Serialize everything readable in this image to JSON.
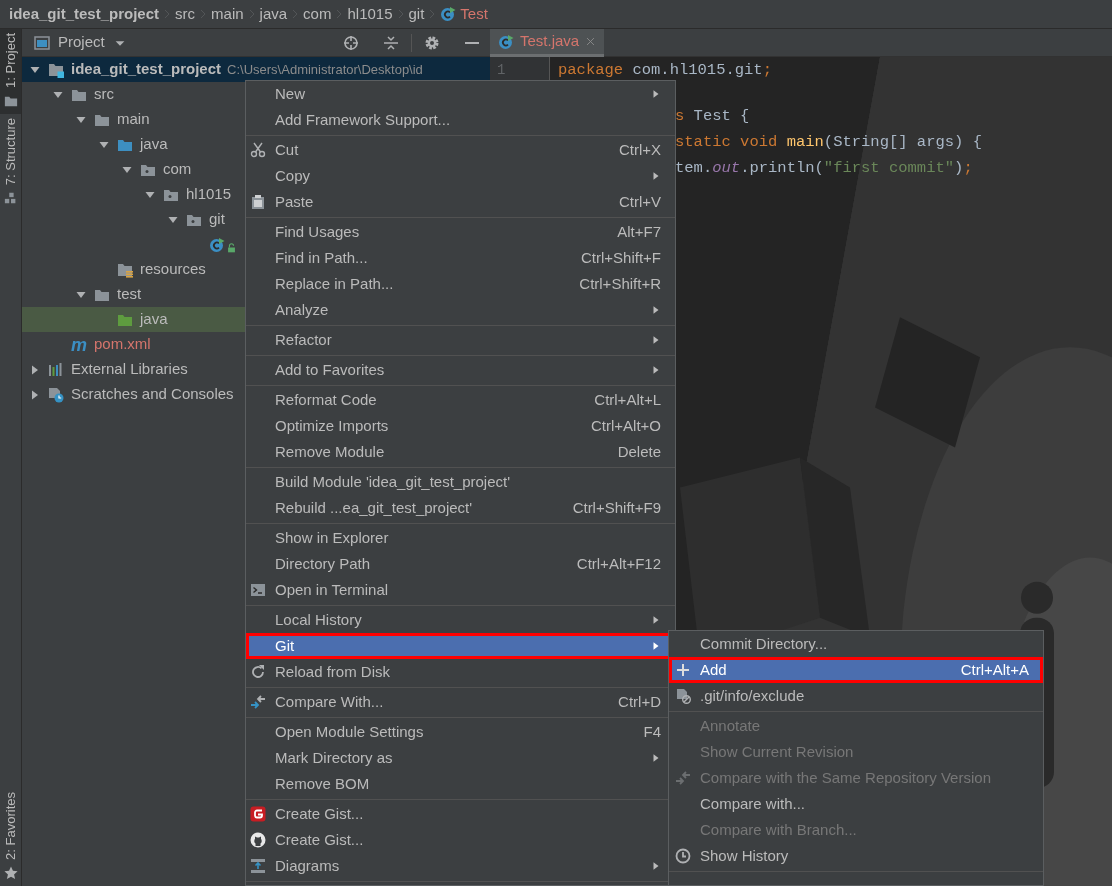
{
  "breadcrumb": [
    {
      "label": "idea_git_test_project",
      "kind": "module",
      "untracked": false
    },
    {
      "label": "src",
      "kind": "folder",
      "untracked": false
    },
    {
      "label": "main",
      "kind": "folder",
      "untracked": false
    },
    {
      "label": "java",
      "kind": "folder",
      "untracked": false
    },
    {
      "label": "com",
      "kind": "folder",
      "untracked": false
    },
    {
      "label": "hl1015",
      "kind": "folder",
      "untracked": false
    },
    {
      "label": "git",
      "kind": "folder",
      "untracked": false
    },
    {
      "label": "Test",
      "kind": "class",
      "untracked": true
    }
  ],
  "tool_strip": {
    "top": [
      {
        "label": "1: Project",
        "selected": true
      },
      {
        "label": "7: Structure",
        "selected": false
      }
    ],
    "bottom": [
      {
        "label": "2: Favorites",
        "selected": false
      }
    ]
  },
  "project_panel": {
    "title": "Project",
    "tree": [
      {
        "label": "idea_git_test_project",
        "kind": "module",
        "detail": "C:\\Users\\Administrator\\Desktop\\id",
        "expanded": true,
        "selected": false,
        "highlighted": true,
        "untracked": false,
        "children": [
          {
            "label": "src",
            "kind": "folder",
            "expanded": true,
            "selected": false,
            "highlighted": false,
            "untracked": false,
            "children": [
              {
                "label": "main",
                "kind": "folder",
                "expanded": true,
                "selected": false,
                "highlighted": false,
                "untracked": false,
                "children": [
                  {
                    "label": "java",
                    "kind": "source",
                    "expanded": true,
                    "selected": false,
                    "highlighted": false,
                    "untracked": false,
                    "children": [
                      {
                        "label": "com",
                        "kind": "package",
                        "expanded": true,
                        "selected": false,
                        "highlighted": false,
                        "untracked": false,
                        "children": [
                          {
                            "label": "hl1015",
                            "kind": "package",
                            "expanded": true,
                            "selected": false,
                            "highlighted": false,
                            "untracked": false,
                            "children": [
                              {
                                "label": "git",
                                "kind": "package",
                                "expanded": true,
                                "selected": false,
                                "highlighted": false,
                                "untracked": false,
                                "children": [
                                  {
                                    "kind": "class",
                                    "locked": true,
                                    "selected": false,
                                    "highlighted": false
                                  }
                                ]
                              }
                            ]
                          }
                        ]
                      }
                    ]
                  },
                  {
                    "label": "resources",
                    "kind": "resources",
                    "selected": false,
                    "highlighted": false,
                    "untracked": false
                  }
                ]
              },
              {
                "label": "test",
                "kind": "folder",
                "expanded": true,
                "selected": false,
                "highlighted": false,
                "untracked": false,
                "children": [
                  {
                    "label": "java",
                    "kind": "test",
                    "selected": true,
                    "highlighted": false,
                    "untracked": false
                  }
                ]
              }
            ]
          },
          {
            "label": "pom.xml",
            "kind": "maven",
            "glyph": "m",
            "selected": false,
            "highlighted": false,
            "untracked": true
          }
        ]
      },
      {
        "label": "External Libraries",
        "kind": "libraries",
        "expanded": false,
        "selected": false,
        "highlighted": false,
        "untracked": false
      },
      {
        "label": "Scratches and Consoles",
        "kind": "scratches",
        "expanded": false,
        "selected": false,
        "highlighted": false,
        "untracked": false
      }
    ]
  },
  "editor": {
    "tabs": [
      {
        "label": "Test.java",
        "kind": "class",
        "untracked": true,
        "selected": true
      }
    ],
    "gutter": [
      "1"
    ],
    "code_lines": [
      {
        "gap_before": false,
        "partial": false,
        "tokens": [
          {
            "kind": "keyword",
            "text": "package"
          },
          {
            "kind": "plain",
            "text": " com.hl1015.git"
          },
          {
            "kind": "keyword",
            "text": ";"
          }
        ]
      },
      {
        "gap_before": true,
        "partial": true,
        "tokens": [
          {
            "kind": "keyword",
            "text": "s"
          },
          {
            "kind": "plain",
            "text": " Test {"
          }
        ]
      },
      {
        "gap_before": false,
        "partial": true,
        "tokens": [
          {
            "kind": "keyword",
            "text": "static void "
          },
          {
            "kind": "method",
            "text": "main"
          },
          {
            "kind": "plain",
            "text": "(String[] args) {"
          }
        ]
      },
      {
        "gap_before": false,
        "partial": true,
        "tokens": [
          {
            "kind": "plain",
            "text": "tem."
          },
          {
            "kind": "field",
            "text": "out"
          },
          {
            "kind": "plain",
            "text": ".println("
          },
          {
            "kind": "string",
            "text": "\"first commit\""
          },
          {
            "kind": "plain",
            "text": ")"
          },
          {
            "kind": "keyword",
            "text": ";"
          }
        ]
      }
    ]
  },
  "context_menu": {
    "items": [
      {
        "kind": "plain",
        "label": "New",
        "submenu": true,
        "selected": false,
        "disabled": false,
        "outlined": false
      },
      {
        "kind": "plain",
        "label": "Add Framework Support...",
        "selected": false,
        "disabled": false,
        "outlined": false
      },
      {
        "kind": "separator"
      },
      {
        "kind": "scissors",
        "label": "Cut",
        "shortcut": "Ctrl+X",
        "selected": false,
        "disabled": false,
        "outlined": false
      },
      {
        "kind": "plain",
        "label": "Copy",
        "submenu": true,
        "selected": false,
        "disabled": false,
        "outlined": false
      },
      {
        "kind": "clipboard",
        "label": "Paste",
        "shortcut": "Ctrl+V",
        "selected": false,
        "disabled": false,
        "outlined": false
      },
      {
        "kind": "separator"
      },
      {
        "kind": "plain",
        "label": "Find Usages",
        "shortcut": "Alt+F7",
        "selected": false,
        "disabled": false,
        "outlined": false
      },
      {
        "kind": "plain",
        "label": "Find in Path...",
        "shortcut": "Ctrl+Shift+F",
        "selected": false,
        "disabled": false,
        "outlined": false
      },
      {
        "kind": "plain",
        "label": "Replace in Path...",
        "shortcut": "Ctrl+Shift+R",
        "selected": false,
        "disabled": false,
        "outlined": false
      },
      {
        "kind": "plain",
        "label": "Analyze",
        "submenu": true,
        "selected": false,
        "disabled": false,
        "outlined": false
      },
      {
        "kind": "separator"
      },
      {
        "kind": "plain",
        "label": "Refactor",
        "submenu": true,
        "selected": false,
        "disabled": false,
        "outlined": false
      },
      {
        "kind": "separator"
      },
      {
        "kind": "plain",
        "label": "Add to Favorites",
        "submenu": true,
        "selected": false,
        "disabled": false,
        "outlined": false
      },
      {
        "kind": "separator"
      },
      {
        "kind": "plain",
        "label": "Reformat Code",
        "shortcut": "Ctrl+Alt+L",
        "selected": false,
        "disabled": false,
        "outlined": false
      },
      {
        "kind": "plain",
        "label": "Optimize Imports",
        "shortcut": "Ctrl+Alt+O",
        "selected": false,
        "disabled": false,
        "outlined": false
      },
      {
        "kind": "plain",
        "label": "Remove Module",
        "shortcut": "Delete",
        "selected": false,
        "disabled": false,
        "outlined": false
      },
      {
        "kind": "separator"
      },
      {
        "kind": "plain",
        "label": "Build Module 'idea_git_test_project'",
        "selected": false,
        "disabled": false,
        "outlined": false
      },
      {
        "kind": "plain",
        "label": "Rebuild ...ea_git_test_project'",
        "shortcut": "Ctrl+Shift+F9",
        "selected": false,
        "disabled": false,
        "outlined": false
      },
      {
        "kind": "separator"
      },
      {
        "kind": "plain",
        "label": "Show in Explorer",
        "selected": false,
        "disabled": false,
        "outlined": false
      },
      {
        "kind": "plain",
        "label": "Directory Path",
        "shortcut": "Ctrl+Alt+F12",
        "selected": false,
        "disabled": false,
        "outlined": false
      },
      {
        "kind": "terminal",
        "label": "Open in Terminal",
        "selected": false,
        "disabled": false,
        "outlined": false
      },
      {
        "kind": "separator"
      },
      {
        "kind": "plain",
        "label": "Local History",
        "submenu": true,
        "selected": false,
        "disabled": false,
        "outlined": false
      },
      {
        "kind": "plain",
        "label": "Git",
        "submenu": true,
        "selected": true,
        "disabled": false,
        "outlined": true
      },
      {
        "kind": "reload",
        "label": "Reload from Disk",
        "selected": false,
        "disabled": false,
        "outlined": false
      },
      {
        "kind": "separator"
      },
      {
        "kind": "compare",
        "label": "Compare With...",
        "shortcut": "Ctrl+D",
        "selected": false,
        "disabled": false,
        "outlined": false
      },
      {
        "kind": "separator"
      },
      {
        "kind": "plain",
        "label": "Open Module Settings",
        "shortcut": "F4",
        "selected": false,
        "disabled": false,
        "outlined": false
      },
      {
        "kind": "plain",
        "label": "Mark Directory as",
        "submenu": true,
        "selected": false,
        "disabled": false,
        "outlined": false
      },
      {
        "kind": "plain",
        "label": "Remove BOM",
        "selected": false,
        "disabled": false,
        "outlined": false
      },
      {
        "kind": "separator"
      },
      {
        "kind": "gmark",
        "label": "Create Gist...",
        "selected": false,
        "disabled": false,
        "outlined": false
      },
      {
        "kind": "catmark",
        "label": "Create Gist...",
        "selected": false,
        "disabled": false,
        "outlined": false
      },
      {
        "kind": "diagram",
        "label": "Diagrams",
        "submenu": true,
        "selected": false,
        "disabled": false,
        "outlined": false
      },
      {
        "kind": "separator"
      }
    ]
  },
  "git_submenu": {
    "items": [
      {
        "kind": "plain",
        "label": "Commit Directory...",
        "selected": false,
        "disabled": false,
        "outlined": false
      },
      {
        "kind": "plus",
        "label": "Add",
        "shortcut": "Ctrl+Alt+A",
        "selected": true,
        "disabled": false,
        "outlined": true
      },
      {
        "kind": "blocked",
        "label": ".git/info/exclude",
        "selected": false,
        "disabled": false,
        "outlined": false
      },
      {
        "kind": "separator"
      },
      {
        "kind": "plain",
        "label": "Annotate",
        "selected": false,
        "disabled": true,
        "outlined": false
      },
      {
        "kind": "plain",
        "label": "Show Current Revision",
        "selected": false,
        "disabled": true,
        "outlined": false
      },
      {
        "kind": "comparegrey",
        "label": "Compare with the Same Repository Version",
        "selected": false,
        "disabled": true,
        "outlined": false
      },
      {
        "kind": "plain",
        "label": "Compare with...",
        "selected": false,
        "disabled": false,
        "outlined": false
      },
      {
        "kind": "plain",
        "label": "Compare with Branch...",
        "selected": false,
        "disabled": true,
        "outlined": false
      },
      {
        "kind": "clock",
        "label": "Show History",
        "selected": false,
        "disabled": false,
        "outlined": false
      },
      {
        "kind": "separator"
      }
    ]
  }
}
